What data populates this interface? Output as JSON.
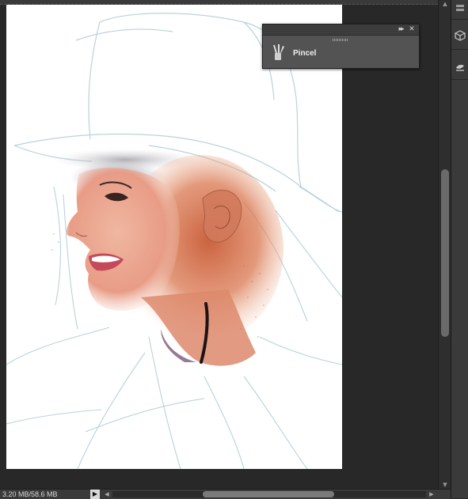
{
  "panel": {
    "title_collapse": "▸▸",
    "title_close": "✕",
    "tool_label": "Pincel",
    "tool_icon": "brush-icon"
  },
  "status": {
    "doc_size": "3.20 MB/58.6 MB",
    "menu_arrow": "▶"
  },
  "scroll": {
    "up": "▲",
    "down": "▼",
    "left": "◀",
    "right": "▶"
  },
  "dock": {
    "icons": [
      "panel-icon-1",
      "cube-icon",
      "swatch-icon"
    ]
  },
  "colors": {
    "workspace": "#282828",
    "panel": "#535353",
    "canvas": "#ffffff",
    "sketch_line": "#b9d3d8",
    "skin": "#e89a78"
  }
}
